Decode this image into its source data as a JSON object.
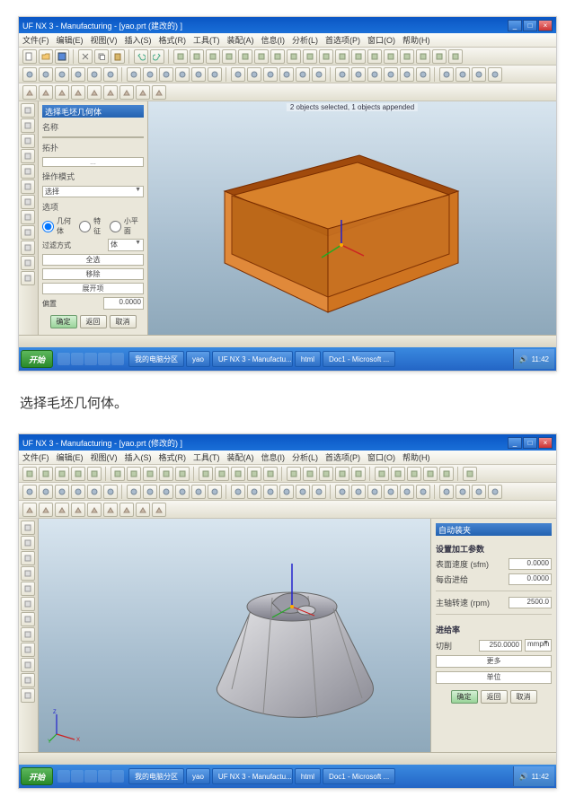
{
  "screenshot1": {
    "title": "UF NX 3 - Manufacturing - [yao.prt (建改的) ]",
    "menu": [
      "文件(F)",
      "编辑(E)",
      "视图(V)",
      "插入(S)",
      "格式(R)",
      "工具(T)",
      "装配(A)",
      "信息(I)",
      "分析(L)",
      "首选项(P)",
      "窗口(O)",
      "帮助(H)"
    ],
    "panel": {
      "title": "选择毛坯几何体",
      "name_label": "名称",
      "topo_label": "拓扑",
      "sel_mode_label": "操作模式",
      "sel_mode_value": "选择",
      "opt_label": "选项",
      "radio1": "几何体",
      "radio2": "特征",
      "radio3": "小平面",
      "filter_label": "过滤方式",
      "filter_value": "体",
      "offset_label": "偏置",
      "offset_value": "0.0000",
      "btn_all": "全选",
      "btn_remove": "移除",
      "btn_expand": "展开项",
      "ok": "确定",
      "back": "返回",
      "cancel": "取消"
    },
    "status": "2 objects selected, 1 objects appended"
  },
  "caption": "选择毛坯几何体。",
  "screenshot2": {
    "title": "UF NX 3 - Manufacturing - [yao.prt (修改的) ]",
    "menu": [
      "文件(F)",
      "编辑(E)",
      "视图(V)",
      "插入(S)",
      "格式(R)",
      "工具(T)",
      "装配(A)",
      "信息(I)",
      "分析(L)",
      "首选项(P)",
      "窗口(O)",
      "帮助(H)"
    ],
    "panel": {
      "title": "自动装夹",
      "set_plane": "设置加工参数",
      "surf_speed": "表面速度 (sfm)",
      "surf_speed_val": "0.0000",
      "feed_tooth": "每齿进给",
      "feed_tooth_val": "0.0000",
      "spindle": "主轴转速 (rpm)",
      "spindle_val": "2500.0",
      "feedrate": "进给率",
      "cut": "切削",
      "cut_val": "250.0000",
      "cut_unit": "mmpm",
      "more": "更多",
      "units": "单位",
      "ok": "确定",
      "back": "返回",
      "cancel": "取消"
    }
  },
  "taskbar": {
    "start": "开始",
    "items": [
      "我的电脑分区",
      "yao",
      "UF NX 3 - Manufactu...",
      "html",
      "Doc1 - Microsoft ..."
    ],
    "time": "11:42"
  }
}
